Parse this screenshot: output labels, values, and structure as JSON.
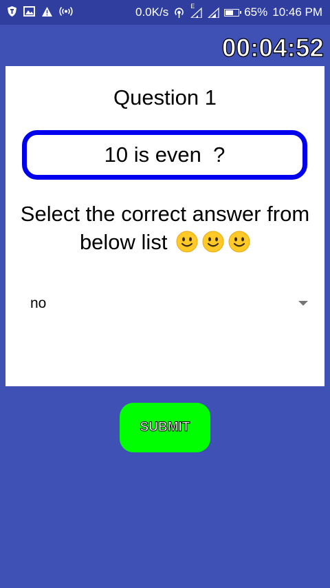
{
  "status_bar": {
    "left_icons": [
      "shield-app-icon",
      "image-icon",
      "warning-icon",
      "hotspot-icon"
    ],
    "network_speed": "0.0K/s",
    "battery_percent": "65%",
    "battery_level": 0.65,
    "time": "10:46 PM",
    "edge_label": "E"
  },
  "timer": "00:04:52",
  "quiz": {
    "question_number": "Question 1",
    "question_text": "10 is even  ?",
    "instruction": "Select the correct answer from below list",
    "emoji_count": 3,
    "dropdown_selected": "no",
    "submit_label": "SUBMIT"
  },
  "colors": {
    "background": "#3F51B5",
    "status_bar": "#303F9F",
    "question_border": "#0000EE",
    "submit": "#00FF00"
  }
}
